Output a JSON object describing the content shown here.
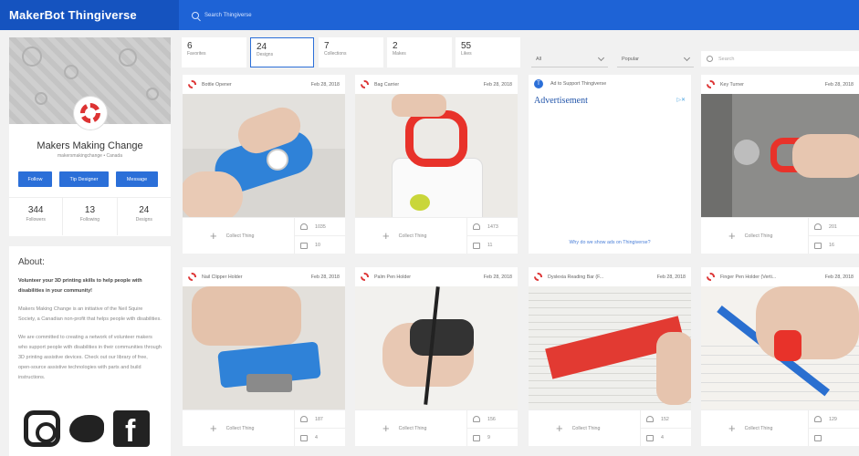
{
  "app": {
    "logo": "MakerBot Thingiverse",
    "search_placeholder": "Search Thingiverse"
  },
  "profile": {
    "name": "Makers Making Change",
    "subtitle": "makersmakingchange • Canada",
    "buttons": [
      "Follow",
      "Tip Designer",
      "Message"
    ],
    "stats": [
      {
        "value": "344",
        "label": "Followers"
      },
      {
        "value": "13",
        "label": "Following"
      },
      {
        "value": "24",
        "label": "Designs"
      }
    ]
  },
  "about": {
    "title": "About:",
    "lead": "Volunteer your 3D printing skills to help people with disabilities in your community!",
    "p1": "Makers Making Change is an initiative of the Neil Squire Society, a Canadian non-profit that helps people with disabilities.",
    "p2": "We are committed to creating a network of volunteer makers who support people with disabilities in their communities through 3D printing assistive devices. Check out our library of free, open-source assistive technologies with parts and build instructions."
  },
  "tabs": [
    {
      "value": "6",
      "label": "Favorites"
    },
    {
      "value": "24",
      "label": "Designs"
    },
    {
      "value": "7",
      "label": "Collections"
    },
    {
      "value": "2",
      "label": "Makes"
    },
    {
      "value": "55",
      "label": "Likes"
    }
  ],
  "filters": {
    "category": "All",
    "sort": "Popular",
    "search_placeholder": "Search"
  },
  "collect_label": "Collect Thing",
  "cards": [
    {
      "title": "Bottle Opener",
      "date": "Feb 28, 2018",
      "likes": "1035",
      "comments": "10"
    },
    {
      "title": "Bag Carrier",
      "date": "Feb 28, 2018",
      "likes": "1473",
      "comments": "11"
    },
    {
      "title": "Key Turner",
      "date": "Feb 28, 2018",
      "likes": "201",
      "comments": "16"
    },
    {
      "title": "Nail Clipper Holder",
      "date": "Feb 28, 2018",
      "likes": "187",
      "comments": "4"
    },
    {
      "title": "Palm Pen Holder",
      "date": "Feb 28, 2018",
      "likes": "156",
      "comments": "9"
    },
    {
      "title": "Dyslexia Reading Bar (F...",
      "date": "Feb 28, 2018",
      "likes": "152",
      "comments": "4"
    },
    {
      "title": "Finger Pen Holder (Verti...",
      "date": "Feb 28, 2018",
      "likes": "129",
      "comments": ""
    }
  ],
  "ad": {
    "header": "Ad to Support Thingiverse",
    "label": "Advertisement",
    "why": "Why do we show ads on Thingiverse?"
  }
}
